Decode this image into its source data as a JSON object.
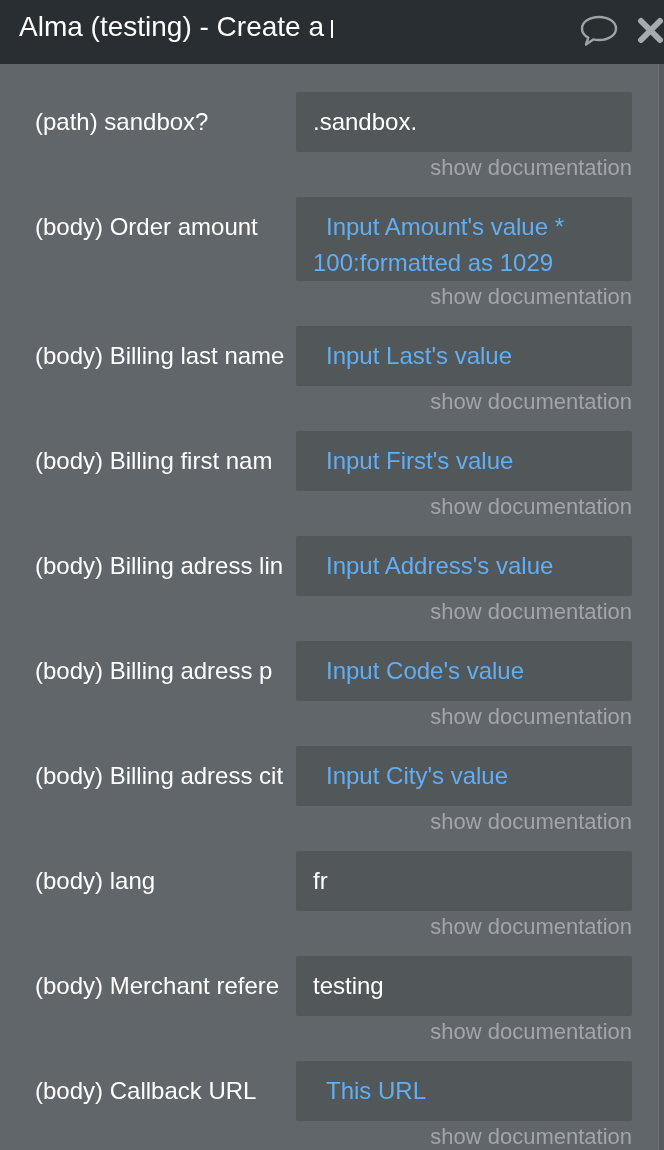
{
  "window": {
    "title": "Alma (testing) - Create a",
    "editing": true
  },
  "fields": [
    {
      "label": "(path) sandbox?",
      "kind": "text",
      "value": ".sandbox.",
      "link": "show documentation"
    },
    {
      "label": "(body) Order amount",
      "kind": "expression",
      "value": "Input Amount's value * 100:formatted as 1029",
      "link": "show documentation"
    },
    {
      "label": "(body) Billing last name",
      "kind": "expression",
      "value": "Input Last's value",
      "link": "show documentation"
    },
    {
      "label": "(body) Billing first nam",
      "kind": "expression",
      "value": "Input First's value",
      "link": "show documentation"
    },
    {
      "label": "(body) Billing adress lin",
      "kind": "expression",
      "value": "Input Address's value",
      "link": "show documentation"
    },
    {
      "label": "(body) Billing adress p",
      "kind": "expression",
      "value": "Input Code's value",
      "link": "show documentation"
    },
    {
      "label": "(body) Billing adress cit",
      "kind": "expression",
      "value": "Input City's value",
      "link": "show documentation"
    },
    {
      "label": "(body) lang",
      "kind": "text",
      "value": "fr",
      "link": "show documentation"
    },
    {
      "label": "(body) Merchant refere",
      "kind": "text",
      "value": "testing",
      "link": "show documentation"
    },
    {
      "label": "(body) Callback URL",
      "kind": "expression",
      "value": "This URL",
      "link": "show documentation"
    }
  ]
}
